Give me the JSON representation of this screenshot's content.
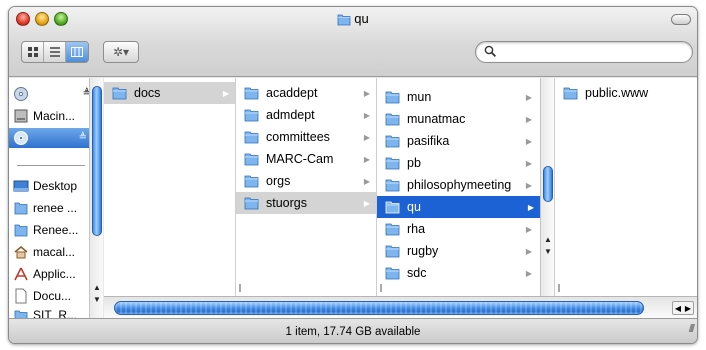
{
  "window": {
    "title": "qu",
    "status_text": "1 item, 17.74 GB available"
  },
  "toolbar": {
    "view_icons": [
      "icon-view-icon",
      "list-view-icon",
      "column-view-icon"
    ],
    "action_glyph": "✲▾",
    "search": {
      "value": "",
      "placeholder": ""
    }
  },
  "sidebar": {
    "items": [
      {
        "label": "",
        "icon": "disk-icon",
        "eject": "≜"
      },
      {
        "label": "Macin...",
        "icon": "hard-drive-icon"
      },
      {
        "label": "",
        "icon": "disk-icon",
        "eject": "≜",
        "selected": true
      },
      {
        "label": "Desktop",
        "icon": "desktop-icon"
      },
      {
        "label": "renee ...",
        "icon": "folder-icon"
      },
      {
        "label": "Renee...",
        "icon": "folder-icon"
      },
      {
        "label": "macal...",
        "icon": "home-icon"
      },
      {
        "label": "Applic...",
        "icon": "applications-icon"
      },
      {
        "label": "Docu...",
        "icon": "document-icon"
      },
      {
        "label": "SIT_R...",
        "icon": "folder-icon"
      }
    ]
  },
  "columns": [
    {
      "items": [
        {
          "name": "docs",
          "state": "path"
        }
      ]
    },
    {
      "items": [
        {
          "name": "acaddept"
        },
        {
          "name": "admdept"
        },
        {
          "name": "committees"
        },
        {
          "name": "MARC-Cam"
        },
        {
          "name": "orgs"
        },
        {
          "name": "stuorgs",
          "state": "path"
        }
      ]
    },
    {
      "items": [
        {
          "name": "mun"
        },
        {
          "name": "munatmac"
        },
        {
          "name": "pasifika"
        },
        {
          "name": "pb"
        },
        {
          "name": "philosophymeeting"
        },
        {
          "name": "qu",
          "state": "selected"
        },
        {
          "name": "rha"
        },
        {
          "name": "rugby"
        },
        {
          "name": "sdc"
        }
      ]
    },
    {
      "items": [
        {
          "name": "public.www",
          "state": "leaf"
        }
      ]
    }
  ],
  "colors": {
    "selection": "#1c62d4",
    "path_highlight": "#d4d4d4",
    "scroll_blue": "#3a86e4"
  }
}
